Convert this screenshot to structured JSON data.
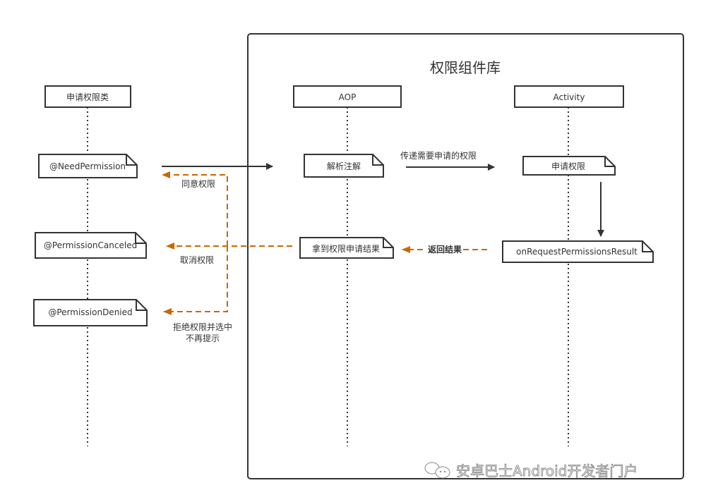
{
  "diagram": {
    "container_title": "权限组件库",
    "colors": {
      "line": "#333333",
      "accent": "#cc6600"
    },
    "lifelines": [
      {
        "id": "requester",
        "label": "申请权限类"
      },
      {
        "id": "aop",
        "label": "AOP"
      },
      {
        "id": "activity",
        "label": "Activity"
      }
    ],
    "notes": {
      "need_permission": "@NeedPermission",
      "permission_canceled": "@PermissionCanceled",
      "permission_denied": "@PermissionDenied",
      "parse_annotation": "解析注解",
      "get_result": "拿到权限申请结果",
      "request_permission": "申请权限",
      "on_result": "onRequestPermissionsResult"
    },
    "messages": {
      "pass_permissions": "传递需要申请的权限",
      "return_result": "返回结果",
      "granted": "同意权限",
      "canceled": "取消权限",
      "denied_line1": "拒绝权限并选中",
      "denied_line2": "不再提示"
    }
  },
  "watermark": {
    "icon": "wechat-icon",
    "text": "安卓巴士Android开发者门户"
  }
}
